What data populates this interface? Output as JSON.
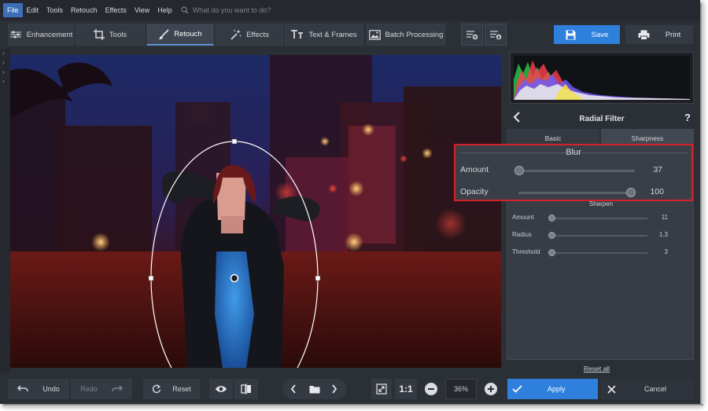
{
  "menu": {
    "items": [
      "File",
      "Edit",
      "Tools",
      "Retouch",
      "Effects",
      "View",
      "Help"
    ],
    "search_placeholder": "What do you want to do?"
  },
  "toolbar": {
    "tabs": [
      "Enhancement",
      "Tools",
      "Retouch",
      "Effects",
      "Text & Frames",
      "Batch Processing"
    ],
    "selected_tab": "Retouch",
    "save_label": "Save",
    "print_label": "Print"
  },
  "panel": {
    "title": "Radial Filter",
    "help": "?",
    "sub_tabs": [
      "Basic",
      "Sharpness"
    ],
    "selected_sub_tab": "Sharpness",
    "blur": {
      "title": "Blur",
      "sliders": [
        {
          "label": "Amount",
          "value": "37",
          "fraction": 0.1
        },
        {
          "label": "Opacity",
          "value": "100",
          "fraction": 1.0
        }
      ]
    },
    "sharpen": {
      "title": "Sharpen",
      "sliders": [
        {
          "label": "Amount",
          "value": "11",
          "fraction": 0.0
        },
        {
          "label": "Radius",
          "value": "1.3",
          "fraction": 0.0
        },
        {
          "label": "Threshold",
          "value": "3",
          "fraction": 0.0
        }
      ]
    },
    "reset_all": "Reset all"
  },
  "bottom": {
    "undo": "Undo",
    "redo": "Redo",
    "reset": "Reset",
    "one_to_one": "1:1",
    "zoom": "36%",
    "apply": "Apply",
    "cancel": "Cancel"
  },
  "colors": {
    "accent": "#2f7fdc",
    "highlight": "#d4212a"
  }
}
